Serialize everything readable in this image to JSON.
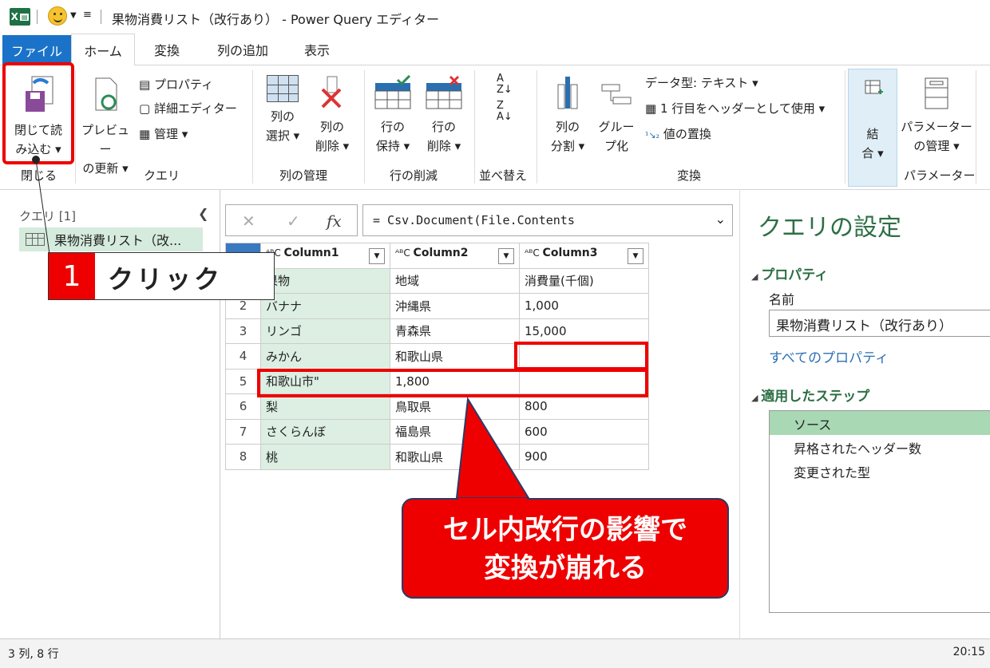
{
  "title": "果物消費リスト（改行あり） - Power Query エディター",
  "tabs": [
    "ファイル",
    "ホーム",
    "変換",
    "列の追加",
    "表示"
  ],
  "ribbon": {
    "close_load": [
      "閉じて読",
      "み込む ▾"
    ],
    "preview": [
      "プレビュー",
      "の更新 ▾"
    ],
    "properties": "プロパティ",
    "advanced_editor": "詳細エディター",
    "manage": "管理 ▾",
    "col_select": [
      "列の",
      "選択 ▾"
    ],
    "col_delete": [
      "列の",
      "削除 ▾"
    ],
    "row_keep": [
      "行の",
      "保持 ▾"
    ],
    "row_delete": [
      "行の",
      "削除 ▾"
    ],
    "col_split": [
      "列の",
      "分割 ▾"
    ],
    "group_by": [
      "グルー",
      "プ化"
    ],
    "data_type": "データ型: テキスト ▾",
    "first_row_header": "1 行目をヘッダーとして使用 ▾",
    "replace_values": "値の置換",
    "combine": [
      "結",
      "合 ▾"
    ],
    "params": [
      "パラメーター",
      "の管理 ▾"
    ],
    "groups": {
      "close": "閉じる",
      "query": "クエリ",
      "col_manage": "列の管理",
      "row_reduce": "行の削減",
      "sort": "並べ替え",
      "transform": "変換",
      "params": "パラメーター"
    }
  },
  "left": {
    "header": "クエリ [1]",
    "query_item": "果物消費リスト（改..."
  },
  "formula": "= Csv.Document(File.Contents",
  "table": {
    "headers": [
      "Column1",
      "Column2",
      "Column3"
    ],
    "rows": [
      [
        "1",
        "果物",
        "地域",
        "消費量(千個)"
      ],
      [
        "2",
        "バナナ",
        "沖縄県",
        "1,000"
      ],
      [
        "3",
        "リンゴ",
        "青森県",
        "15,000"
      ],
      [
        "4",
        "みかん",
        "和歌山県",
        ""
      ],
      [
        "5",
        "和歌山市\"",
        "1,800",
        ""
      ],
      [
        "6",
        "梨",
        "鳥取県",
        "800"
      ],
      [
        "7",
        "さくらんぼ",
        "福島県",
        "600"
      ],
      [
        "8",
        "桃",
        "和歌山県",
        "900"
      ]
    ]
  },
  "right": {
    "title": "クエリの設定",
    "props_header": "プロパティ",
    "name_label": "名前",
    "name_value": "果物消費リスト（改行あり）",
    "all_props": "すべてのプロパティ",
    "steps_header": "適用したステップ",
    "steps": [
      "ソース",
      "昇格されたヘッダー数",
      "変更された型"
    ]
  },
  "status": {
    "left": "3 列, 8 行",
    "right": "20:15"
  },
  "annotation": {
    "num": "1",
    "label": "クリック",
    "callout": [
      "セル内改行の影響で",
      "変換が崩れる"
    ]
  }
}
